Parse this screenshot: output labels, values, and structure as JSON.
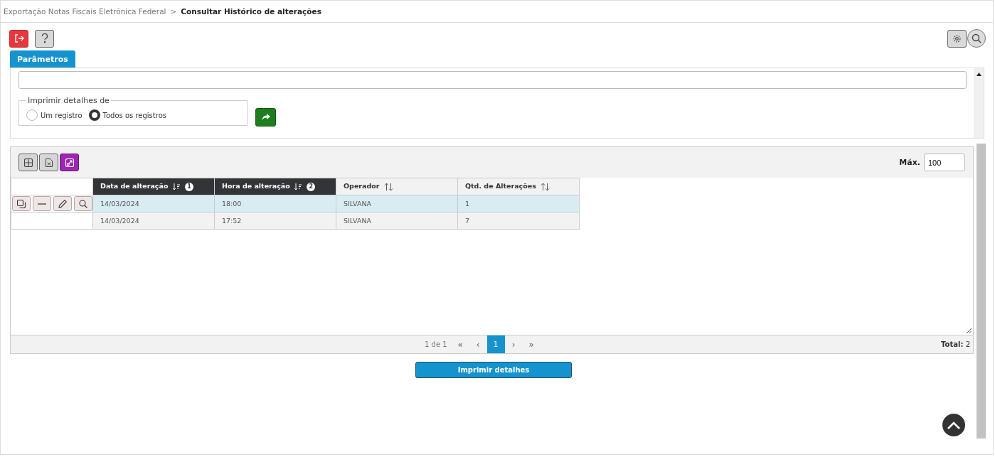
{
  "breadcrumb": {
    "parent": "Exportação Notas Fiscais Eletrônica Federal",
    "separator": ">",
    "current": "Consultar Histórico de alterações"
  },
  "tab": {
    "label": "Parâmetros"
  },
  "print_options": {
    "legend": "Imprimir detalhes de",
    "options": [
      {
        "label": "Um registro",
        "selected": false
      },
      {
        "label": "Todos os registros",
        "selected": true
      }
    ]
  },
  "grid": {
    "max_label": "Máx.",
    "max_value": "100",
    "columns": [
      {
        "label": "Data de alteração",
        "sorted": true,
        "order": "1"
      },
      {
        "label": "Hora de alteração",
        "sorted": true,
        "order": "2"
      },
      {
        "label": "Operador",
        "sorted": false
      },
      {
        "label": "Qtd. de Alterações",
        "sorted": false
      }
    ],
    "rows": [
      {
        "selected": true,
        "cells": [
          "14/03/2024",
          "18:00",
          "SILVANA",
          "1"
        ]
      },
      {
        "selected": false,
        "cells": [
          "14/03/2024",
          "17:52",
          "SILVANA",
          "7"
        ]
      }
    ],
    "pager": {
      "info": "1 de 1",
      "first": "«",
      "prev": "‹",
      "pages": [
        {
          "label": "1",
          "selected": true
        }
      ],
      "next": "›",
      "last": "»"
    },
    "total_label": "Total:",
    "total_value": "2"
  },
  "print_button": "Imprimir detalhes"
}
